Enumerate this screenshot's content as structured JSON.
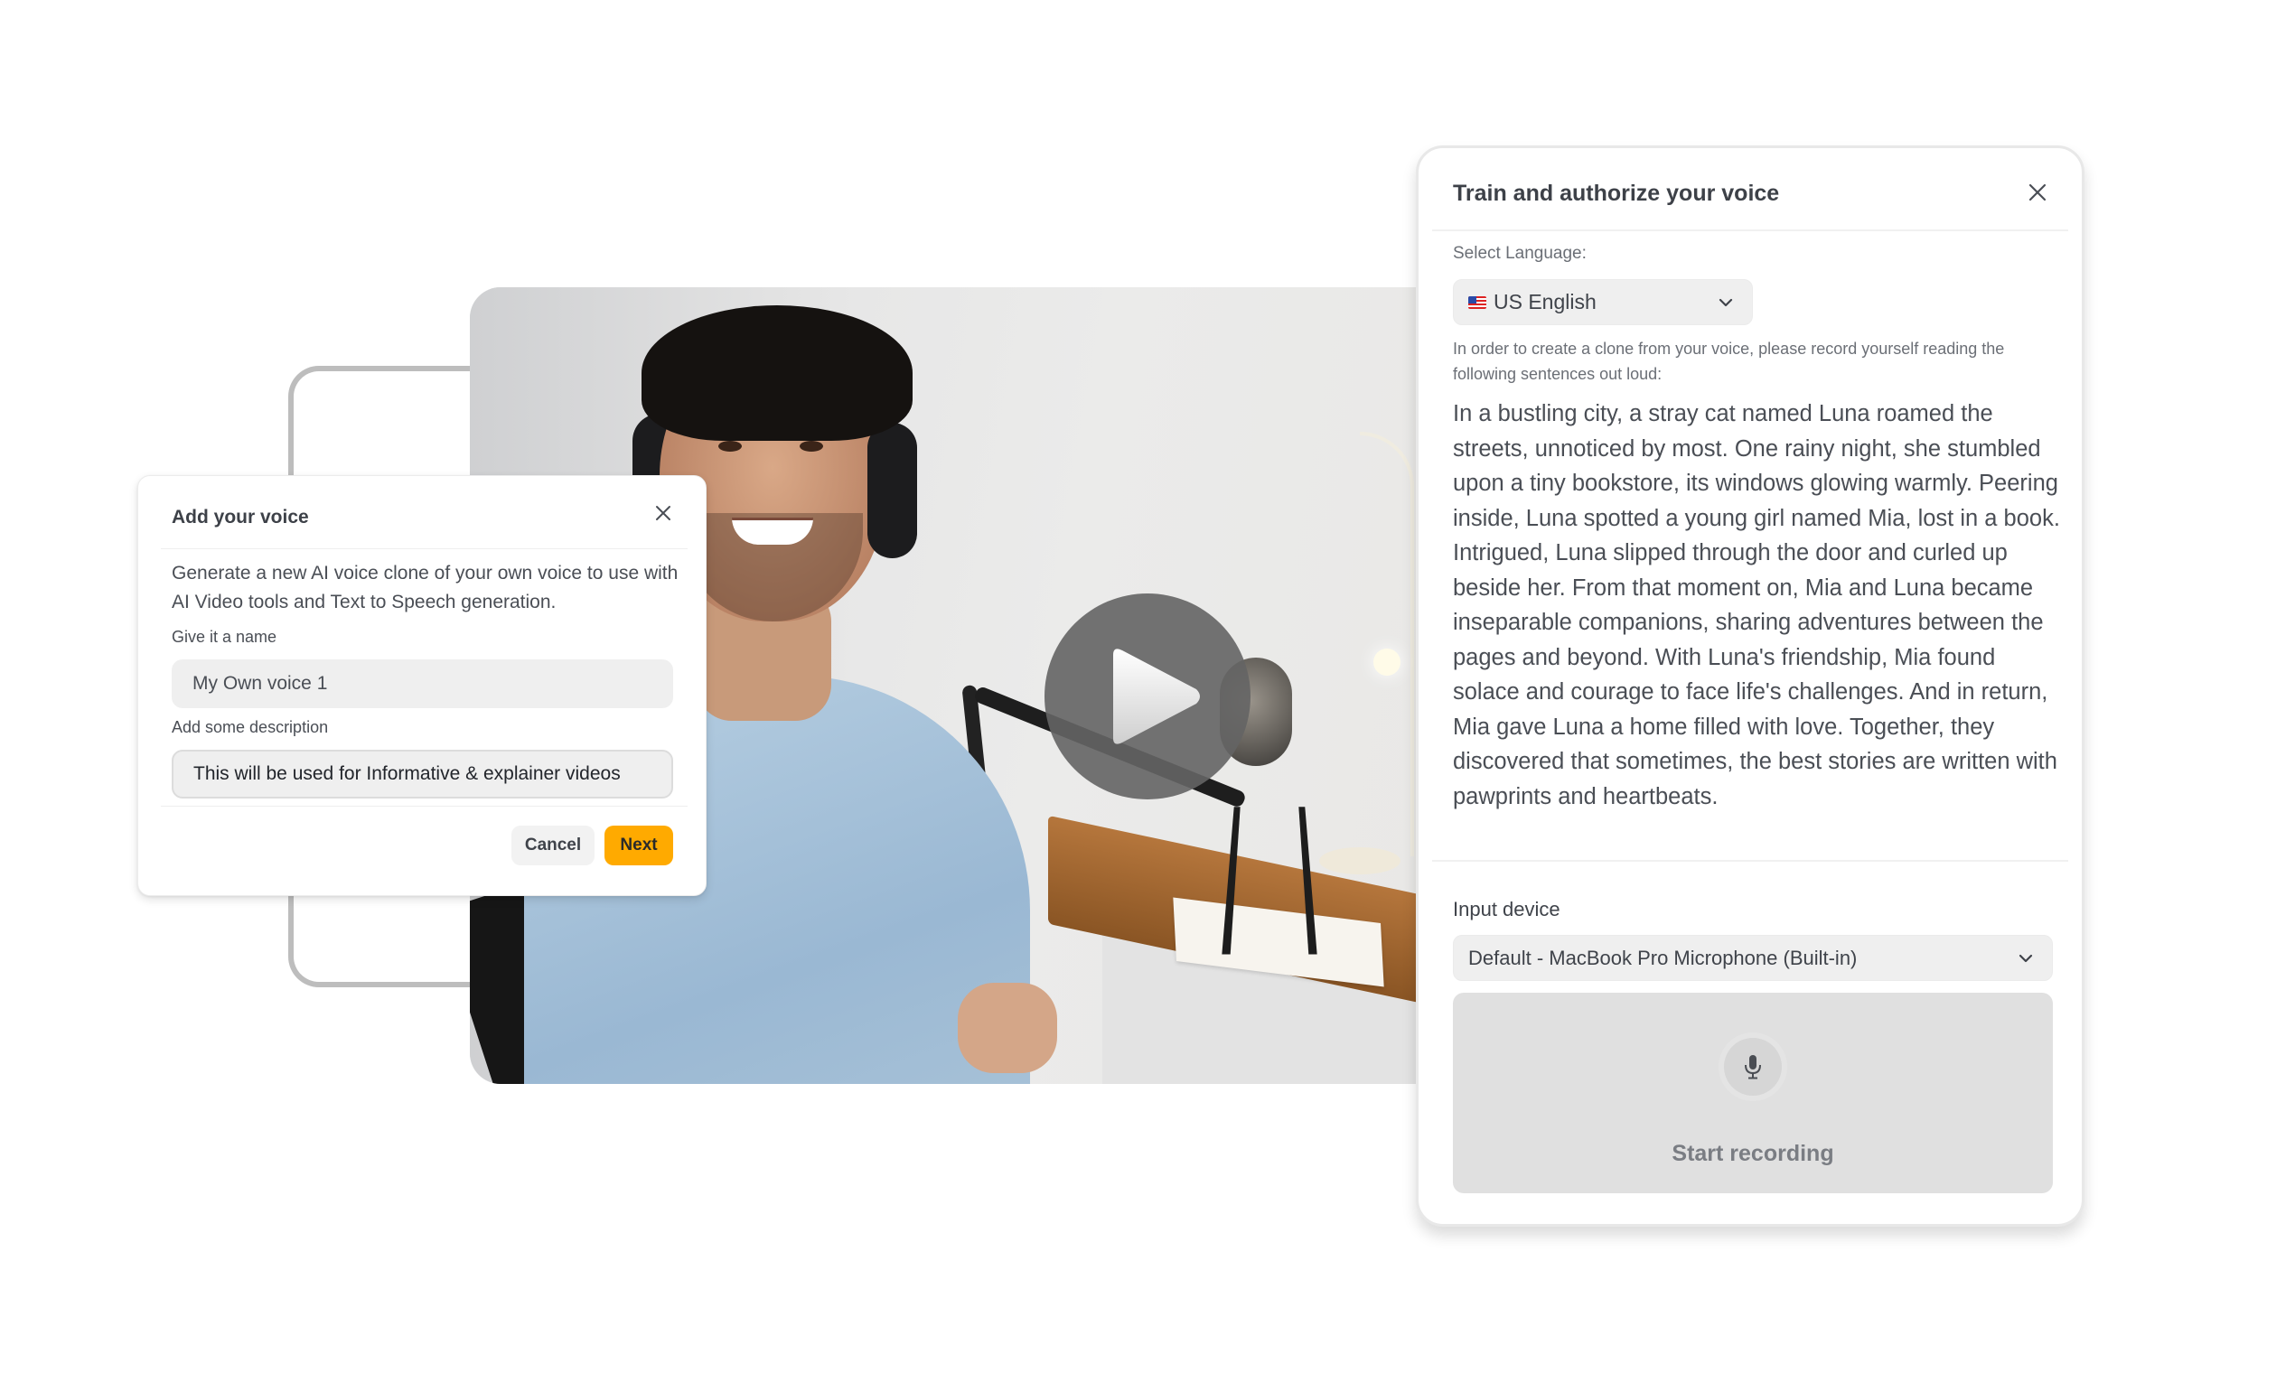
{
  "add_voice_dialog": {
    "title": "Add your voice",
    "close_icon": "close-icon",
    "description": "Generate a new AI voice clone of your own voice to use with AI Video tools and Text to Speech generation.",
    "name_label": "Give it a name",
    "name_value": "My Own voice 1",
    "description_label": "Add some description",
    "description_value": "This will be used for Informative & explainer videos",
    "cancel_label": "Cancel",
    "next_label": "Next",
    "accent_color": "#FFAA00"
  },
  "video": {
    "play_icon": "play-icon"
  },
  "train_panel": {
    "title": "Train and authorize your voice",
    "close_icon": "close-icon",
    "language_label": "Select Language:",
    "language_value": "US English",
    "language_flag": "us-flag-icon",
    "instructions": "In order to create a clone from your voice, please record yourself reading the following sentences out loud:",
    "story": "In a bustling city, a stray cat named Luna roamed the streets, unnoticed by most. One rainy night, she stumbled upon a tiny bookstore, its windows glowing warmly. Peering inside, Luna spotted a young girl named Mia, lost in a book. Intrigued, Luna slipped through the door and curled up beside her. From that moment on, Mia and Luna became inseparable companions, sharing adventures between the pages and beyond. With Luna's friendship, Mia found solace and courage to face life's challenges. And in return, Mia gave Luna a home filled with love. Together, they discovered that sometimes, the best stories are written with pawprints and heartbeats.",
    "input_device_label": "Input device",
    "input_device_value": "Default - MacBook Pro Microphone (Built-in)",
    "record_icon": "microphone-icon",
    "record_label": "Start recording"
  }
}
